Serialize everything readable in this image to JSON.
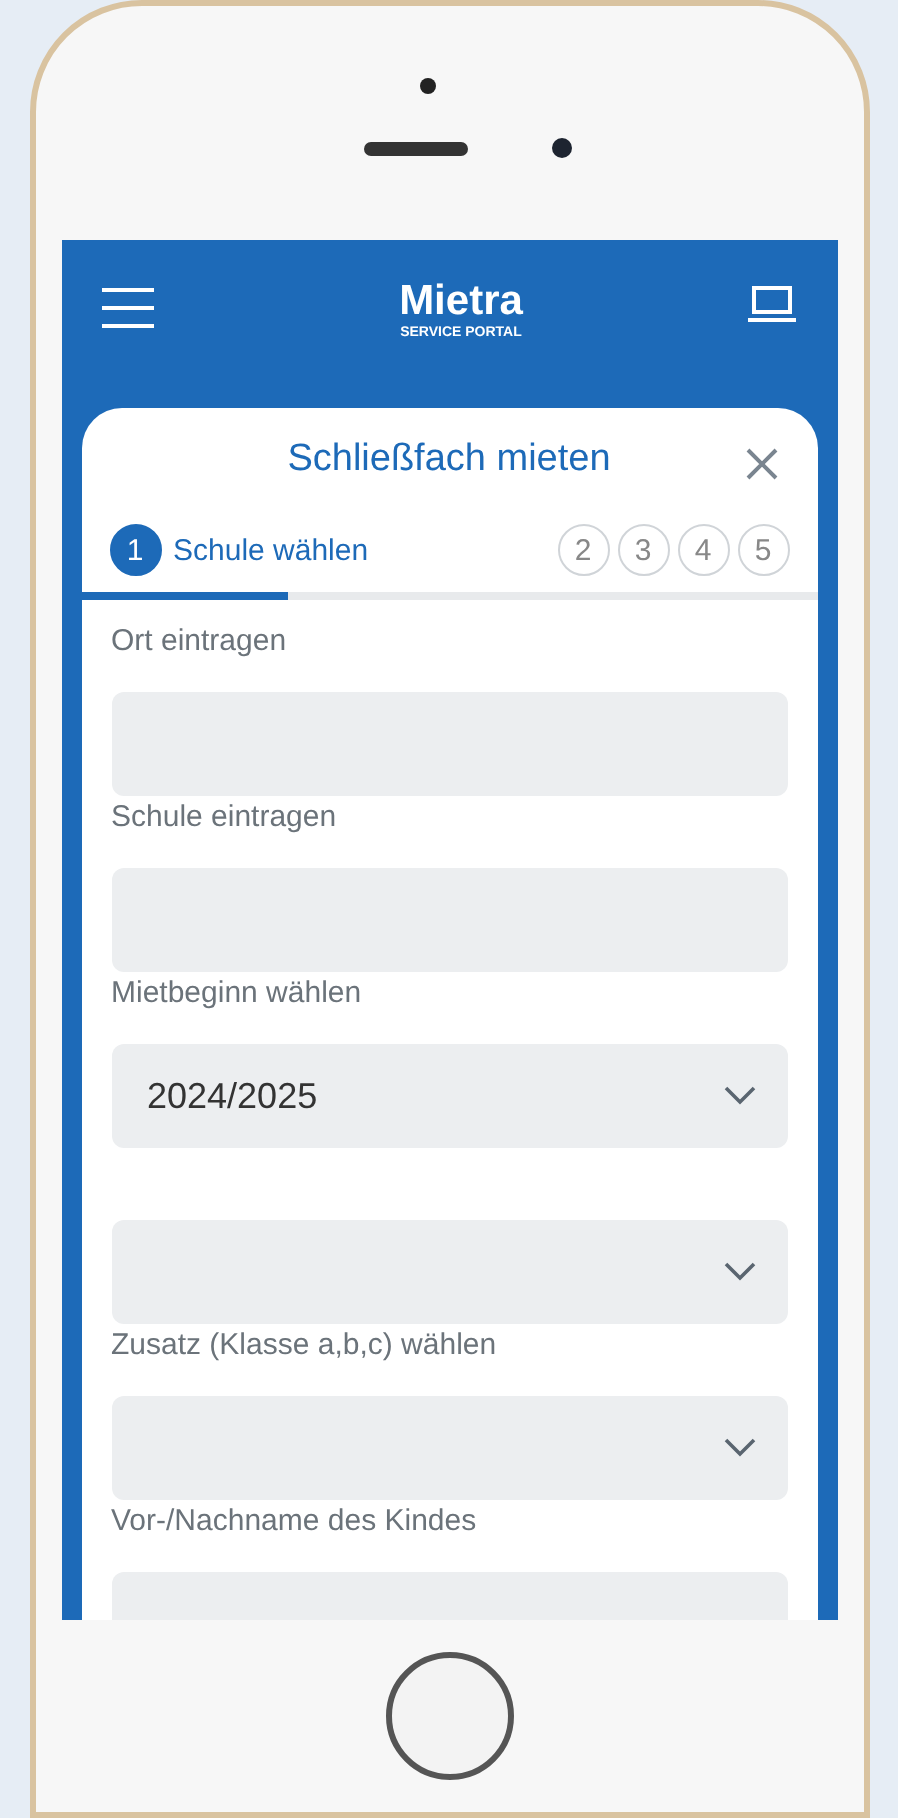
{
  "header": {
    "logo": "Mietra",
    "logo_subtitle": "SERVICE PORTAL"
  },
  "dialog": {
    "title": "Schließfach mieten",
    "steps": [
      {
        "number": "1",
        "label": "Schule wählen",
        "selected": true
      },
      {
        "number": "2",
        "selected": false
      },
      {
        "number": "3",
        "selected": false
      },
      {
        "number": "4",
        "selected": false
      },
      {
        "number": "5",
        "selected": false
      }
    ],
    "progress": {
      "level": 0.28
    },
    "fields": [
      {
        "label": "Ort eintragen",
        "kind": "text"
      },
      {
        "label": "Schule eintragen",
        "kind": "text"
      },
      {
        "label": "Mietbeginn wählen",
        "kind": "select",
        "value": "2024/2025"
      },
      {
        "kind": "select"
      },
      {
        "label": "Zusatz (Klasse a,b,c) wählen",
        "kind": "select"
      },
      {
        "label": "Vor-/Nachname des Kindes",
        "kind": "text"
      }
    ]
  }
}
